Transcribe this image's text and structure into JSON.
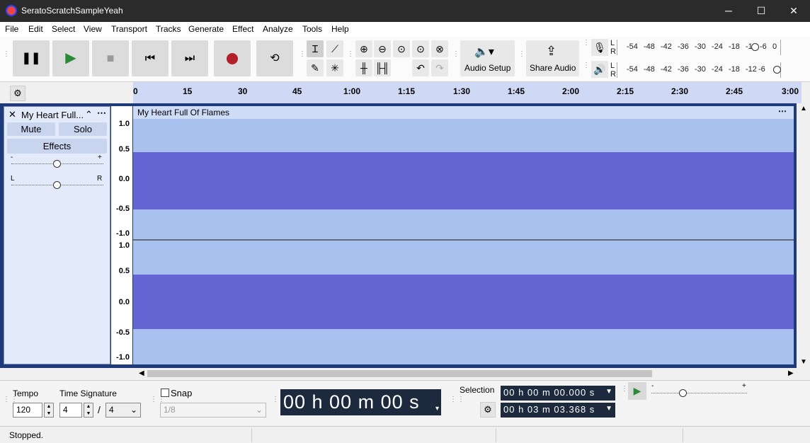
{
  "window": {
    "title": "SeratoScratchSampleYeah",
    "minimize": "─",
    "maximize": "☐",
    "close": "✕"
  },
  "menu": [
    "File",
    "Edit",
    "Select",
    "View",
    "Transport",
    "Tracks",
    "Generate",
    "Effect",
    "Analyze",
    "Tools",
    "Help"
  ],
  "toolbar": {
    "audio_setup": "Audio Setup",
    "share_audio": "Share Audio"
  },
  "meters": {
    "rec_labels": [
      "-54",
      "-48",
      "-42",
      "-36",
      "-30",
      "-24",
      "-18",
      "-12",
      "-6",
      "0"
    ],
    "play_labels": [
      "-54",
      "-48",
      "-42",
      "-36",
      "-30",
      "-24",
      "-18",
      "-12",
      "-6",
      "0"
    ],
    "l": "L",
    "r": "R"
  },
  "ruler": {
    "ticks": [
      "0",
      "15",
      "30",
      "45",
      "1:00",
      "1:15",
      "1:30",
      "1:45",
      "2:00",
      "2:15",
      "2:30",
      "2:45",
      "3:00"
    ]
  },
  "track": {
    "name": "My Heart Full...",
    "clip_name": "My Heart Full Of Flames",
    "mute": "Mute",
    "solo": "Solo",
    "effects": "Effects",
    "gain_minus": "-",
    "gain_plus": "+",
    "pan_l": "L",
    "pan_r": "R",
    "scale": [
      "1.0",
      "0.5",
      "0.0",
      "-0.5",
      "-1.0"
    ]
  },
  "bottom": {
    "tempo_label": "Tempo",
    "tempo_value": "120",
    "timesig_label": "Time Signature",
    "timesig_num": "4",
    "timesig_sep": "/",
    "timesig_den": "4",
    "snap_label": "Snap",
    "snap_value": "1/8",
    "time_display": "00 h 00 m 00 s",
    "selection_label": "Selection",
    "sel_start": "00 h 00 m 00.000 s",
    "sel_end": "00 h 03 m 03.368 s",
    "speed_minus": "-",
    "speed_plus": "+"
  },
  "status": {
    "text": "Stopped."
  }
}
